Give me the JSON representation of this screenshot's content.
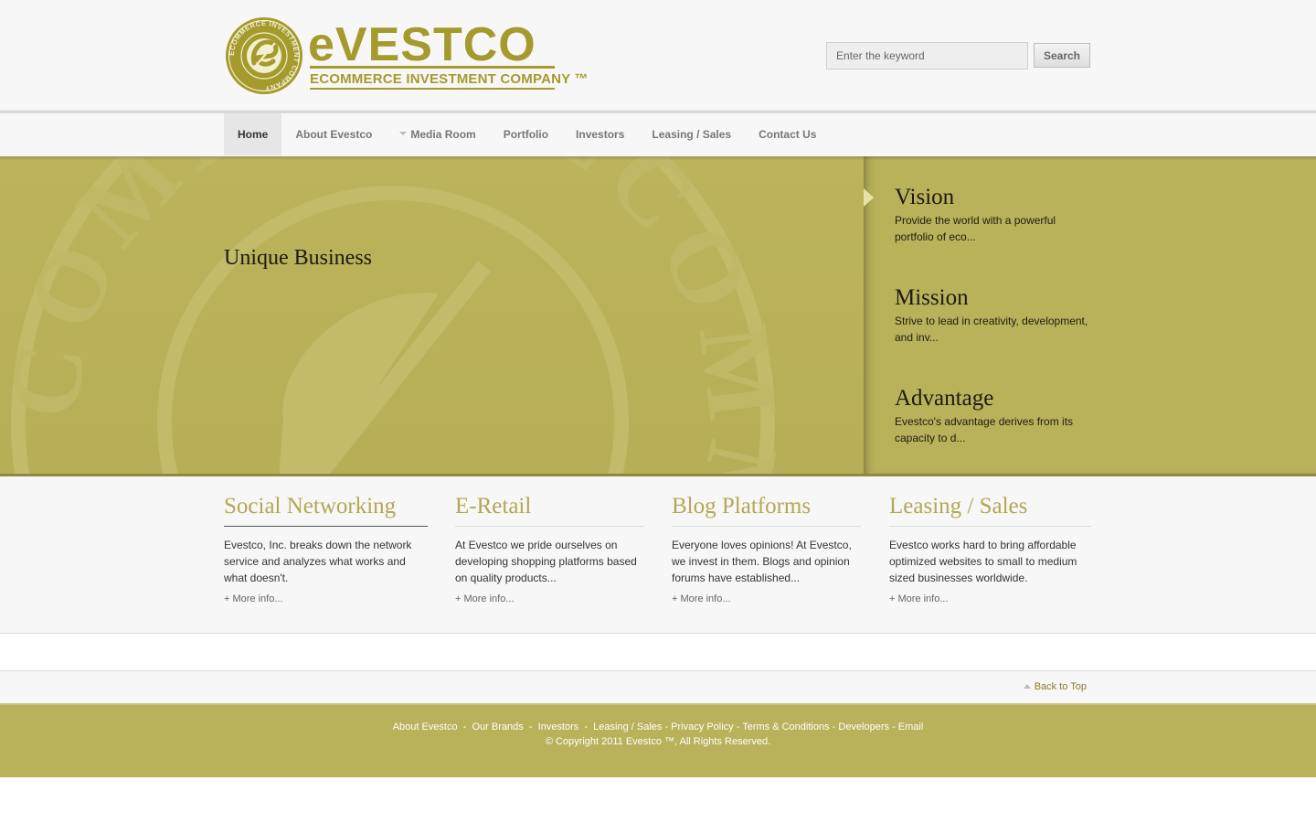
{
  "header": {
    "logo": {
      "wordmark": "eVESTCO",
      "tagline": "ECOMMERCE INVESTMENT COMPANY ™",
      "seal_text": "ECOMMERCE INVESTMENT COMPANY"
    },
    "search": {
      "placeholder": "Enter the keyword",
      "button_label": "Search"
    }
  },
  "nav": {
    "items": [
      {
        "label": "Home",
        "active": true
      },
      {
        "label": "About Evestco"
      },
      {
        "label": "Media Room",
        "dropdown": true
      },
      {
        "label": "Portfolio"
      },
      {
        "label": "Investors"
      },
      {
        "label": "Leasing / Sales"
      },
      {
        "label": "Contact Us"
      }
    ]
  },
  "hero": {
    "title": "Unique Business",
    "features": [
      {
        "title": "Vision",
        "text": "Provide the world with a powerful portfolio of eco..."
      },
      {
        "title": "Mission",
        "text": "Strive to lead in creativity, development, and inv..."
      },
      {
        "title": "Advantage",
        "text": "Evestco's advantage derives from its capacity to d..."
      }
    ]
  },
  "columns": [
    {
      "title": "Social Networking",
      "text": "Evestco, Inc. breaks down the network service and analyzes what works and what doesn't.",
      "more": "+ More info..."
    },
    {
      "title": "E-Retail",
      "text": "At Evestco we pride ourselves on developing shopping platforms based on quality products...",
      "more": "+ More info..."
    },
    {
      "title": "Blog Platforms",
      "text": "Everyone loves opinions! At Evestco, we invest in them. Blogs and opinion forums have established...",
      "more": "+ More info..."
    },
    {
      "title": "Leasing / Sales",
      "text": "Evestco works hard to bring affordable optimized websites to small to medium sized businesses worldwide.",
      "more": "+ More info..."
    }
  ],
  "back_to_top": "Back to Top",
  "footer": {
    "links": [
      "About Evestco",
      "Our Brands",
      "Investors",
      "Leasing / Sales",
      "Privacy Policy",
      "Terms & Conditions",
      "Developers",
      "Email"
    ],
    "separators": [
      "  -  ",
      "  -  ",
      "  -  ",
      " - ",
      " - ",
      " - ",
      " - "
    ],
    "copyright": "© Copyright 2011 Evestco ™, All Rights Reserved."
  },
  "colors": {
    "brand_gold": "#a59a2c",
    "hero_olive": "#b9b05a",
    "heading_gold": "#b3a853"
  }
}
